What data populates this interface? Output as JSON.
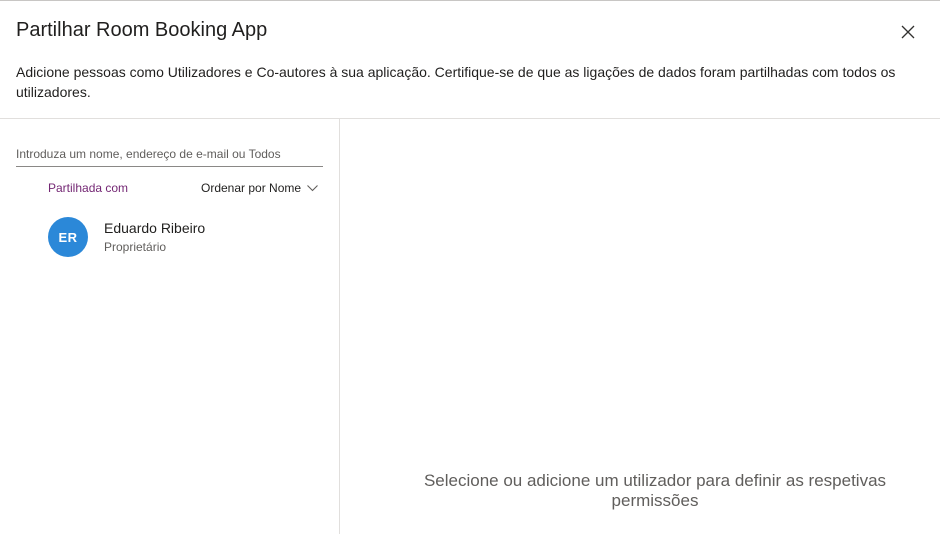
{
  "dialog": {
    "title": "Partilhar Room Booking App",
    "description": "Adicione pessoas como Utilizadores e Co-autores à sua aplicação. Certifique-se de que as ligações de dados foram partilhadas com todos os utilizadores.",
    "close_icon": "close-icon"
  },
  "search": {
    "placeholder": "Introduza um nome, endereço de e-mail ou Todos",
    "value": ""
  },
  "shared_list": {
    "header_label": "Partilhada com",
    "sort_label": "Ordenar por Nome",
    "sort_icon": "chevron-down-icon",
    "users": [
      {
        "initials": "ER",
        "name": "Eduardo Ribeiro",
        "role": "Proprietário",
        "avatar_color": "#2b88d8"
      }
    ]
  },
  "detail_pane": {
    "empty_message": "Selecione ou adicione um utilizador para definir as respetivas permissões"
  },
  "colors": {
    "accent": "#742774",
    "avatar": "#2b88d8",
    "divider": "#e1dfdd"
  }
}
